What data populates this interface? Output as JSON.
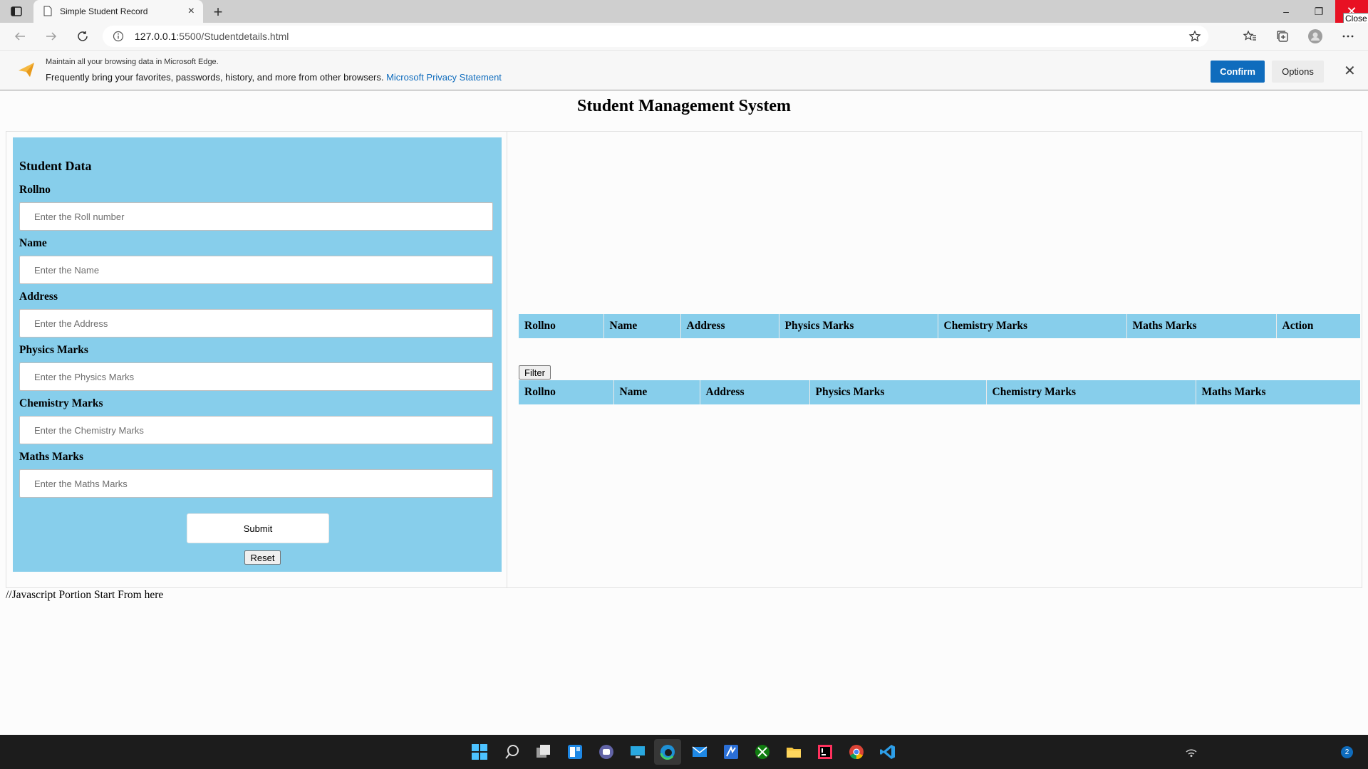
{
  "browser": {
    "tab_title": "Simple Student Record",
    "tab_close": "×",
    "new_tab": "+",
    "url_host": "127.0.0.1",
    "url_rest": ":5500/Studentdetails.html",
    "min": "–",
    "max": "❐",
    "close": "✕",
    "close_tooltip": "Close"
  },
  "infobar": {
    "line1": "Maintain all your browsing data in Microsoft Edge.",
    "line2": "Frequently bring your favorites, passwords, history, and more from other browsers.",
    "link": "Microsoft Privacy Statement",
    "confirm": "Confirm",
    "options": "Options",
    "close": "✕"
  },
  "page": {
    "title": "Student Management System",
    "form": {
      "heading": "Student Data",
      "fields": [
        {
          "label": "Rollno",
          "placeholder": "Enter the Roll number"
        },
        {
          "label": "Name",
          "placeholder": "Enter the Name"
        },
        {
          "label": "Address",
          "placeholder": "Enter the Address"
        },
        {
          "label": "Physics Marks",
          "placeholder": "Enter the Physics Marks"
        },
        {
          "label": "Chemistry Marks",
          "placeholder": "Enter the Chemistry Marks"
        },
        {
          "label": "Maths Marks",
          "placeholder": "Enter the Maths Marks"
        }
      ],
      "submit": "Submit",
      "reset": "Reset"
    },
    "table1": {
      "headers": [
        "Rollno",
        "Name",
        "Address",
        "Physics Marks",
        "Chemistry Marks",
        "Maths Marks",
        "Action"
      ]
    },
    "filter": "Filter",
    "table2": {
      "headers": [
        "Rollno",
        "Name",
        "Address",
        "Physics Marks",
        "Chemistry Marks",
        "Maths Marks"
      ]
    },
    "js_note": "//Javascript Portion Start From here"
  },
  "taskbar": {
    "notification_count": "2"
  },
  "colors": {
    "panel": "#87ceeb",
    "accent": "#0f6cbd",
    "close_red": "#e81123"
  }
}
